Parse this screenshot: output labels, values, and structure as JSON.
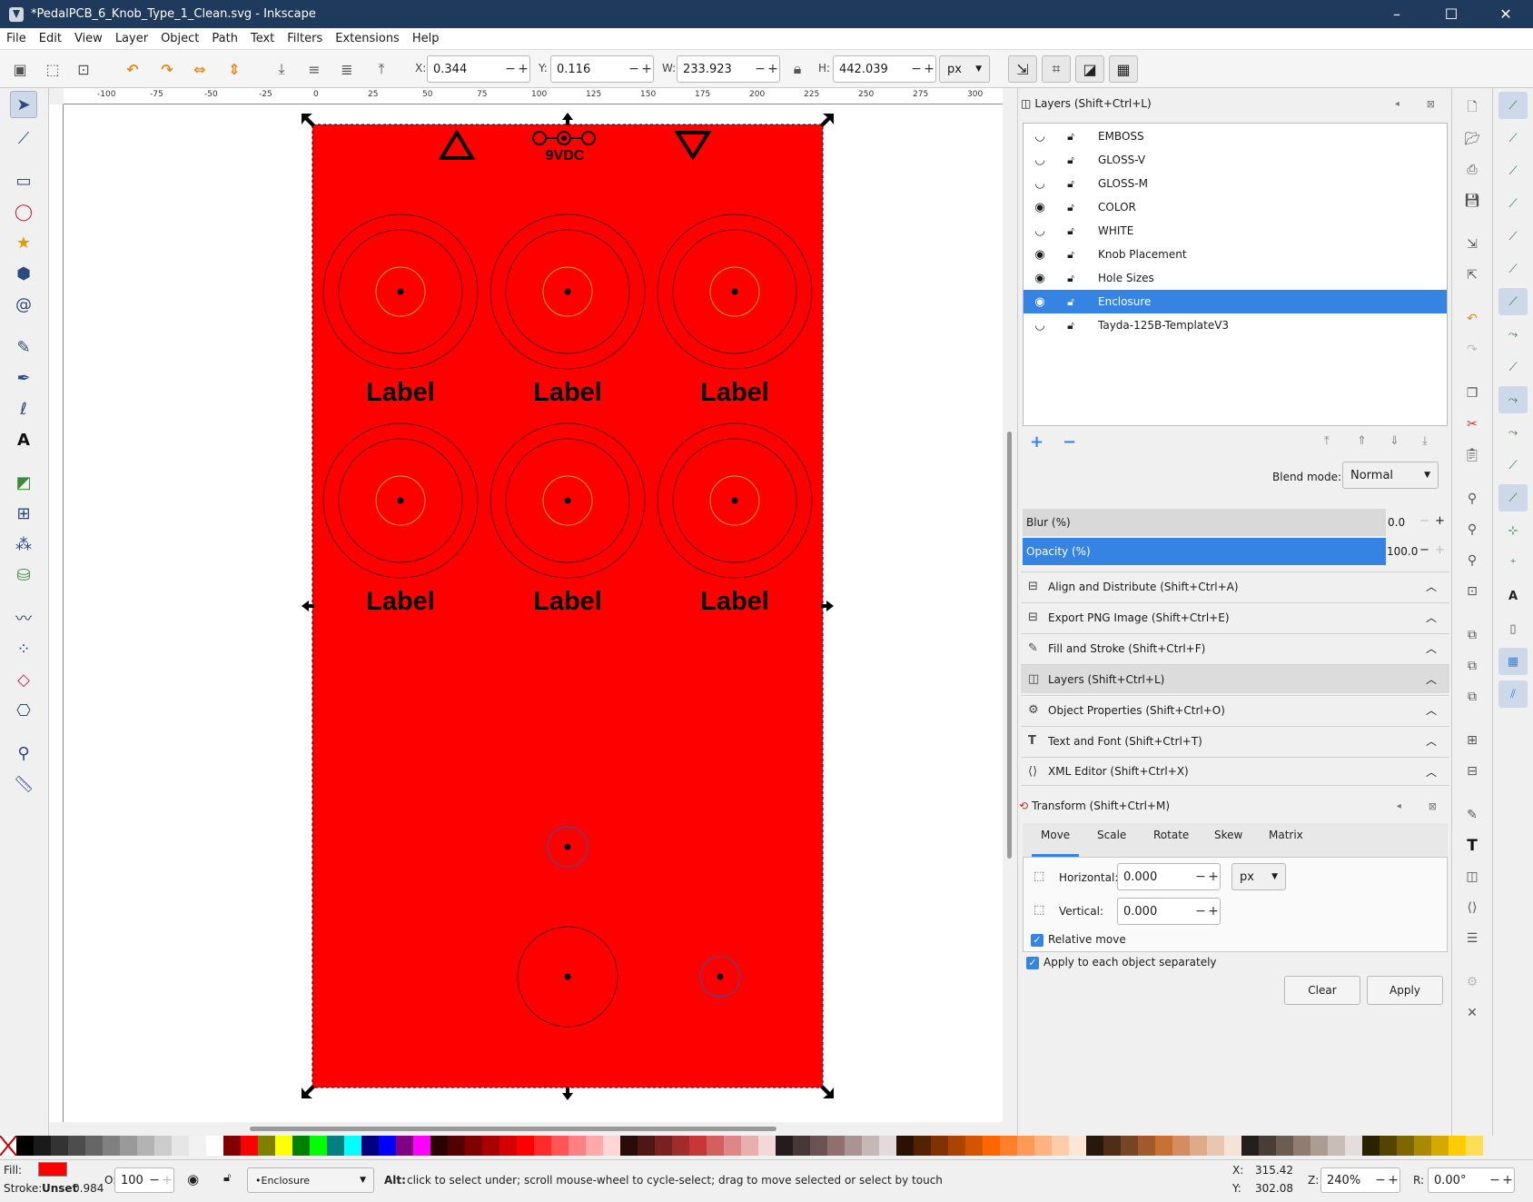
{
  "window": {
    "title": "*PedalPCB_6_Knob_Type_1_Clean.svg - Inkscape",
    "minimize": "–",
    "maximize": "☐",
    "close": "✕"
  },
  "menu": [
    "File",
    "Edit",
    "View",
    "Layer",
    "Object",
    "Path",
    "Text",
    "Filters",
    "Extensions",
    "Help"
  ],
  "toolbar": {
    "x_label": "X:",
    "x_value": "0.344",
    "y_label": "Y:",
    "y_value": "0.116",
    "w_label": "W:",
    "w_value": "233.923",
    "h_label": "H:",
    "h_value": "442.039",
    "unit": "px"
  },
  "ruler": {
    "h_ticks": [
      "-100",
      "-75",
      "-50",
      "-25",
      "0",
      "25",
      "50",
      "75",
      "100",
      "125",
      "150",
      "175",
      "200",
      "225",
      "250",
      "275",
      "300"
    ]
  },
  "canvas": {
    "panel_color": "#ff0000",
    "top_label": "9VDC",
    "knob_label": "Label"
  },
  "layers_panel": {
    "title": "Layers (Shift+Ctrl+L)",
    "layers": [
      "EMBOSS",
      "GLOSS-V",
      "GLOSS-M",
      "COLOR",
      "WHITE",
      "Knob Placement",
      "Hole Sizes",
      "Enclosure",
      "Tayda-125B-TemplateV3"
    ],
    "selected_layer": "Enclosure",
    "blend_label": "Blend mode:",
    "blend_value": "Normal",
    "blur_label": "Blur (%)",
    "blur_value": "0.0",
    "opacity_label": "Opacity (%)",
    "opacity_value": "100.0"
  },
  "docked": [
    "Align and Distribute (Shift+Ctrl+A)",
    "Export PNG Image (Shift+Ctrl+E)",
    "Fill and Stroke (Shift+Ctrl+F)",
    "Layers (Shift+Ctrl+L)",
    "Object Properties (Shift+Ctrl+O)",
    "Text and Font (Shift+Ctrl+T)",
    "XML Editor (Shift+Ctrl+X)"
  ],
  "transform": {
    "title": "Transform (Shift+Ctrl+M)",
    "tabs": [
      "Move",
      "Scale",
      "Rotate",
      "Skew",
      "Matrix"
    ],
    "horizontal_label": "Horizontal:",
    "horizontal_value": "0.000",
    "vertical_label": "Vertical:",
    "vertical_value": "0.000",
    "unit": "px",
    "relative_move": "Relative move",
    "apply_each": "Apply to each object separately",
    "clear": "Clear",
    "apply": "Apply"
  },
  "status": {
    "fill_label": "Fill:",
    "fill_color": "#ff0000",
    "stroke_label": "Stroke:",
    "stroke_value": "Unset",
    "stroke_width": "0.984",
    "opacity_label": "O:",
    "opacity_value": "100",
    "layer": "•Enclosure",
    "message_key": "Alt:",
    "message": "click to select under; scroll mouse-wheel to cycle-select; drag to move selected or select by touch",
    "x_label": "X:",
    "x_value": "315.42",
    "y_label": "Y:",
    "y_value": "302.08",
    "zoom_label": "Z:",
    "zoom_value": "240%",
    "rotate_label": "R:",
    "rotate_value": "0.00°"
  },
  "palette": [
    "#000000",
    "#1a1a1a",
    "#333333",
    "#4d4d4d",
    "#666666",
    "#808080",
    "#999999",
    "#b3b3b3",
    "#cccccc",
    "#e6e6e6",
    "#f2f2f2",
    "#ffffff",
    "#800000",
    "#ff0000",
    "#808000",
    "#ffff00",
    "#008000",
    "#00ff00",
    "#008080",
    "#00ffff",
    "#000080",
    "#0000ff",
    "#800080",
    "#ff00ff",
    "#2b0000",
    "#550000",
    "#800000",
    "#aa0000",
    "#d40000",
    "#ff0000",
    "#ff2a2a",
    "#ff5555",
    "#ff8080",
    "#ffaaaa",
    "#ffd5d5",
    "#280b0b",
    "#501616",
    "#782121",
    "#a02c2c",
    "#c83737",
    "#d35f5f",
    "#de8787",
    "#e9afaf",
    "#f4d7d7",
    "#241c1c",
    "#483737",
    "#6c5353",
    "#916f6f",
    "#ac9393",
    "#c8b7b7",
    "#e3dbdb",
    "#2b1100",
    "#552200",
    "#803300",
    "#aa4400",
    "#d45500",
    "#ff6600",
    "#ff7f2a",
    "#ff9955",
    "#ffb380",
    "#ffccaa",
    "#ffe6d5",
    "#28170b",
    "#502d16",
    "#784421",
    "#a05a2c",
    "#c87137",
    "#d38d5f",
    "#deaa87",
    "#e9c6af",
    "#f4e3d7",
    "#241f1c",
    "#483e37",
    "#6c5d53",
    "#917c6f",
    "#ac9d93",
    "#c8beb7",
    "#e3dedb",
    "#2b2200",
    "#554400",
    "#806600",
    "#aa8800",
    "#d4aa00",
    "#ffcc00",
    "#ffdd55"
  ]
}
